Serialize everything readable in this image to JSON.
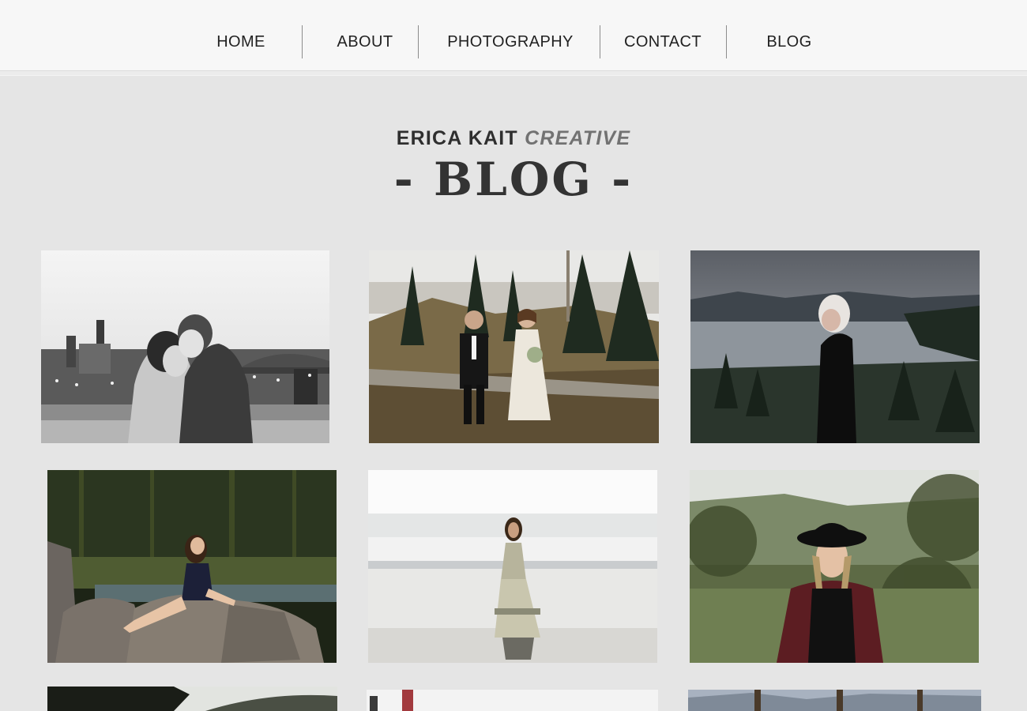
{
  "nav": {
    "items": [
      {
        "label": "HOME"
      },
      {
        "label": "ABOUT"
      },
      {
        "label": "PHOTOGRAPHY"
      },
      {
        "label": "CONTACT"
      },
      {
        "label": "BLOG"
      }
    ]
  },
  "header": {
    "brand_main": "ERICA KAIT",
    "brand_accent": "CREATIVE",
    "page_title": "- BLOG -"
  },
  "posts": [
    {
      "name": "couple-bridge-bw-photo"
    },
    {
      "name": "couple-wedding-log-photo"
    },
    {
      "name": "blonde-woman-river-photo"
    },
    {
      "name": "woman-sitting-rocks-photo"
    },
    {
      "name": "woman-beach-dress-photo"
    },
    {
      "name": "woman-black-hat-photo"
    },
    {
      "name": "forest-hillside-photo"
    },
    {
      "name": "red-post-photo"
    },
    {
      "name": "mountain-lake-trees-photo"
    }
  ]
}
